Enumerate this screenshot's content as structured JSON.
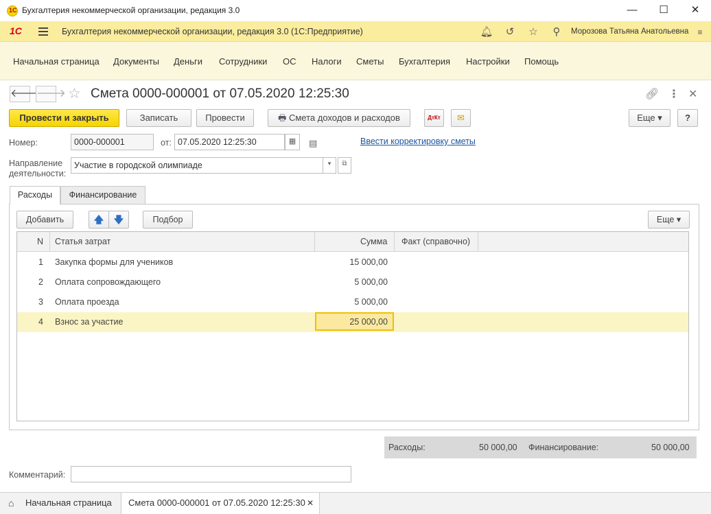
{
  "window": {
    "title": "Бухгалтерия некоммерческой организации, редакция 3.0",
    "logo_text": "1С",
    "minimize": "—",
    "maximize": "☐",
    "close": "✕"
  },
  "appbar": {
    "logo": "1С",
    "title": "Бухгалтерия некоммерческой организации, редакция 3.0  (1С:Предприятие)",
    "user": "Морозова Татьяна Анатольевна"
  },
  "menu": [
    "Начальная страница",
    "Документы",
    "Деньги",
    "Сотрудники",
    "ОС",
    "Налоги",
    "Сметы",
    "Бухгалтерия",
    "Настройки",
    "Помощь"
  ],
  "document": {
    "title": "Смета 0000-000001 от 07.05.2020 12:25:30"
  },
  "toolbar": {
    "post_close": "Провести и закрыть",
    "save": "Записать",
    "post": "Провести",
    "report": "Смета доходов и расходов",
    "dt_kt": "ДтКт",
    "more": "Еще ▾",
    "help": "?"
  },
  "form": {
    "number_label": "Номер:",
    "number_value": "0000-000001",
    "date_label": "от:",
    "date_value": "07.05.2020 12:25:30",
    "correction_link": "Ввести корректировку сметы",
    "direction_label_1": "Направление",
    "direction_label_2": "деятельности:",
    "direction_value": "Участие в городской олимпиаде",
    "comment_label": "Комментарий:",
    "comment_value": ""
  },
  "tabs": [
    "Расходы",
    "Финансирование"
  ],
  "table_toolbar": {
    "add": "Добавить",
    "up": "🡅",
    "down": "🡇",
    "pick": "Подбор",
    "more": "Еще ▾"
  },
  "table": {
    "columns": [
      "N",
      "Статья затрат",
      "Сумма",
      "Факт (справочно)"
    ],
    "rows": [
      {
        "n": "1",
        "item": "Закупка формы для учеников",
        "sum": "15 000,00",
        "fact": ""
      },
      {
        "n": "2",
        "item": "Оплата сопровождающего",
        "sum": "5 000,00",
        "fact": ""
      },
      {
        "n": "3",
        "item": "Оплата проезда",
        "sum": "5 000,00",
        "fact": ""
      },
      {
        "n": "4",
        "item": "Взнос за участие",
        "sum": "25 000,00",
        "fact": ""
      }
    ]
  },
  "totals": {
    "expenses_label": "Расходы:",
    "expenses_value": "50 000,00",
    "funding_label": "Финансирование:",
    "funding_value": "50 000,00"
  },
  "taskbar": {
    "home": "Начальная страница",
    "current": "Смета 0000-000001 от 07.05.2020 12:25:30"
  }
}
